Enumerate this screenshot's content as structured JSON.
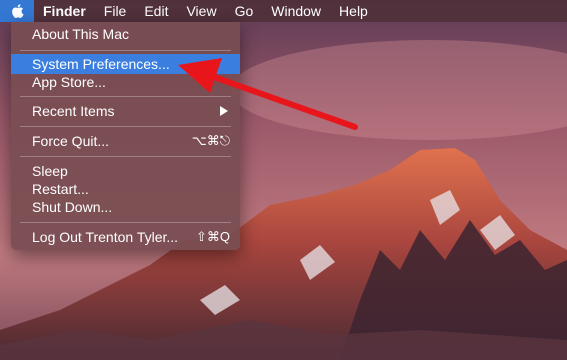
{
  "menubar": {
    "apple_icon": "apple-logo-icon",
    "items": [
      {
        "label": "Finder"
      },
      {
        "label": "File"
      },
      {
        "label": "Edit"
      },
      {
        "label": "View"
      },
      {
        "label": "Go"
      },
      {
        "label": "Window"
      },
      {
        "label": "Help"
      }
    ]
  },
  "apple_menu": {
    "items": [
      {
        "label": "About This Mac",
        "shortcut": ""
      },
      {
        "label": "System Preferences...",
        "shortcut": "",
        "highlighted": true
      },
      {
        "label": "App Store...",
        "shortcut": ""
      },
      {
        "label": "Recent Items",
        "submenu_icon": "triangle-right-icon"
      },
      {
        "label": "Force Quit...",
        "shortcut": "⌥⌘⎋"
      },
      {
        "label": "Sleep",
        "shortcut": ""
      },
      {
        "label": "Restart...",
        "shortcut": ""
      },
      {
        "label": "Shut Down...",
        "shortcut": ""
      },
      {
        "label": "Log Out Trenton Tyler...",
        "shortcut": "⇧⌘Q"
      }
    ]
  },
  "colors": {
    "highlight": "#3a7fe0",
    "annotation_arrow": "#e8161b"
  },
  "annotation": {
    "icon": "red-arrow-icon"
  }
}
